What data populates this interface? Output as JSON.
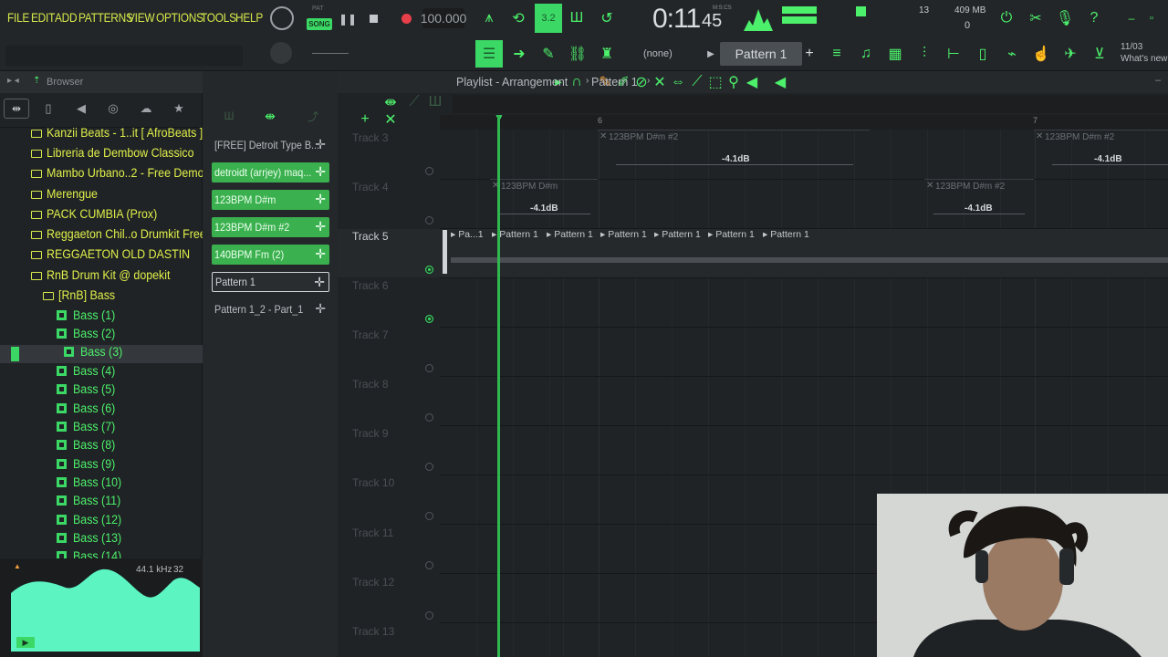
{
  "menu": {
    "items": [
      "FILE",
      "EDIT",
      "ADD",
      "PATTERNS",
      "VIEW",
      "OPTIONS",
      "TOOLS",
      "HELP"
    ],
    "mode_pat": "PAT",
    "mode_song": "SONG"
  },
  "transport": {
    "tempo": "100.000",
    "time": "0:11",
    "time_fraction": "45",
    "time_format": "M:S:CS",
    "cpu_value": "13",
    "memory": "409 MB",
    "polyphony": "0",
    "snap_value": "3.2"
  },
  "toolbar2": {
    "snap_label": "(none)",
    "pattern_label": "Pattern 1",
    "news_date": "11/03",
    "news_text": "What's new"
  },
  "browser": {
    "title": "Browser",
    "items": [
      {
        "label": "Kanzii Beats - 1..it [ AfroBeats ]",
        "type": "folder"
      },
      {
        "label": "Libreria de Dembow Classico",
        "type": "folder"
      },
      {
        "label": "Mambo Urbano..2 - Free Demo",
        "type": "folder"
      },
      {
        "label": "Merengue",
        "type": "folder"
      },
      {
        "label": "PACK CUMBIA (Prox)",
        "type": "folder"
      },
      {
        "label": "Reggaeton Chil..o Drumkit Free",
        "type": "folder"
      },
      {
        "label": "REGGAETON OLD DASTIN",
        "type": "folder"
      },
      {
        "label": "RnB Drum Kit @ dopekit",
        "type": "folder"
      },
      {
        "label": "[RnB] Bass",
        "type": "folder"
      },
      {
        "label": "Bass (1)",
        "type": "file"
      },
      {
        "label": "Bass (2)",
        "type": "file"
      },
      {
        "label": "Bass (3)",
        "type": "file"
      },
      {
        "label": "Bass (4)",
        "type": "file"
      },
      {
        "label": "Bass (5)",
        "type": "file"
      },
      {
        "label": "Bass (6)",
        "type": "file"
      },
      {
        "label": "Bass (7)",
        "type": "file"
      },
      {
        "label": "Bass (8)",
        "type": "file"
      },
      {
        "label": "Bass (9)",
        "type": "file"
      },
      {
        "label": "Bass (10)",
        "type": "file"
      },
      {
        "label": "Bass (11)",
        "type": "file"
      },
      {
        "label": "Bass (12)",
        "type": "file"
      },
      {
        "label": "Bass (13)",
        "type": "file"
      },
      {
        "label": "Bass (14)",
        "type": "file"
      }
    ],
    "sample_rate": "44.1 kHz",
    "bit_depth": "32"
  },
  "patterns": [
    {
      "label": "[FREE] Detroit Type B...",
      "style": "plain"
    },
    {
      "label": "detroidt (arrjey) maq...",
      "style": "sel"
    },
    {
      "label": "123BPM D#m",
      "style": "sel"
    },
    {
      "label": "123BPM D#m #2",
      "style": "sel"
    },
    {
      "label": "140BPM Fm (2)",
      "style": "sel"
    },
    {
      "label": "Pattern 1",
      "style": "cur"
    },
    {
      "label": "Pattern 1_2 - Part_1",
      "style": "plain"
    }
  ],
  "playlist": {
    "title": "Playlist - Arrangement",
    "current_pattern": "Pattern 1",
    "bar_6": "6",
    "bar_7": "7",
    "tracks": [
      "Track 3",
      "Track 4",
      "Track 5",
      "Track 6",
      "Track 7",
      "Track 8",
      "Track 9",
      "Track 10",
      "Track 11",
      "Track 12",
      "Track 13"
    ],
    "audio_clips": [
      {
        "name": "123BPM D#m #2",
        "gain": "-4.1dB"
      },
      {
        "name": "123BPM D#m #2",
        "gain": "-4.1dB"
      },
      {
        "name": "123BPM D#m",
        "gain": "-4.1dB"
      },
      {
        "name": "123BPM D#m #2",
        "gain": "-4.1dB"
      }
    ],
    "pattern_clips": [
      "Pa...1",
      "Pattern 1",
      "Pattern 1",
      "Pattern 1",
      "Pattern 1",
      "Pattern 1",
      "Pattern 1"
    ]
  },
  "colors": {
    "accent": "#4cf06b",
    "folder_text": "#e0f04a",
    "playhead": "#2fb84f"
  }
}
